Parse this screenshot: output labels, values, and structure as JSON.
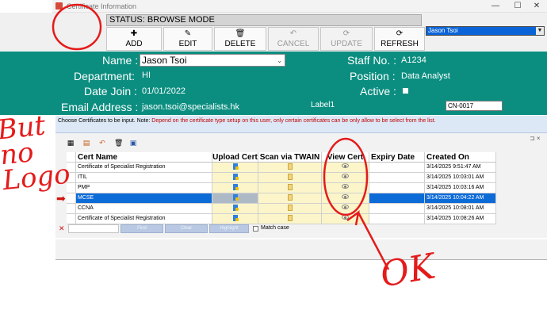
{
  "window": {
    "title": "Certificate Information",
    "controls": {
      "minimize": "—",
      "maximize": "☐",
      "close": "✕"
    }
  },
  "status": {
    "text": "STATUS: BROWSE MODE"
  },
  "user_select": {
    "value": "Jason Tsoi"
  },
  "toolbar": {
    "add": {
      "icon": "✚",
      "label": "ADD"
    },
    "edit": {
      "icon": "✎",
      "label": "EDIT"
    },
    "delete": {
      "icon": "🗑",
      "label": "DELETE"
    },
    "cancel": {
      "icon": "↶",
      "label": "CANCEL"
    },
    "update": {
      "icon": "⟳",
      "label": "UPDATE"
    },
    "refresh": {
      "icon": "⟳",
      "label": "REFRESH"
    }
  },
  "profile": {
    "name_label": "Name :",
    "name_value": "Jason Tsoi",
    "department_label": "Department:",
    "department_value": "HI",
    "date_join_label": "Date Join :",
    "date_join_value": "01/01/2022",
    "email_label": "Email Address :",
    "email_value": "jason.tsoi@specialists.hk",
    "staff_no_label": "Staff No. :",
    "staff_no_value": "A1234",
    "position_label": "Position :",
    "position_value": "Data Analyst",
    "active_label": "Active :",
    "label1": "Label1",
    "cn_value": "CN-0017"
  },
  "note": {
    "prefix": "Choose Certificates to be input. Note: ",
    "warning": "Depend on the certificate type setup on this user, only certain certificates can be only allow to be select from the list."
  },
  "grid": {
    "columns": [
      "Cert Name",
      "Upload Cert",
      "Scan via TWAIN",
      "View Cert",
      "Expiry Date",
      "Created On"
    ],
    "rows": [
      {
        "name": "Certificate of Specialist Registration",
        "expiry": "",
        "created": "3/14/2025 9:51:47 AM"
      },
      {
        "name": "ITIL",
        "expiry": "",
        "created": "3/14/2025 10:03:01 AM"
      },
      {
        "name": "PMP",
        "expiry": "",
        "created": "3/14/2025 10:03:16 AM"
      },
      {
        "name": "MCSE",
        "expiry": "",
        "created": "3/14/2025 10:04:22 AM"
      },
      {
        "name": "CCNA",
        "expiry": "",
        "created": "3/14/2025 10:08:01 AM"
      },
      {
        "name": "Certificate of Specialist Registration",
        "expiry": "",
        "created": "3/14/2025 10:08:26 AM"
      }
    ],
    "selected_row": 3,
    "icons": {
      "upload": "upload-icon",
      "scan": "scan-icon",
      "view": "eye-icon"
    }
  },
  "filter": {
    "find": "Find",
    "clear": "Clear",
    "highlight": "Highlight",
    "match_case": "Match case"
  },
  "annotations": {
    "side_note": "But no Logo",
    "ok": "OK"
  }
}
